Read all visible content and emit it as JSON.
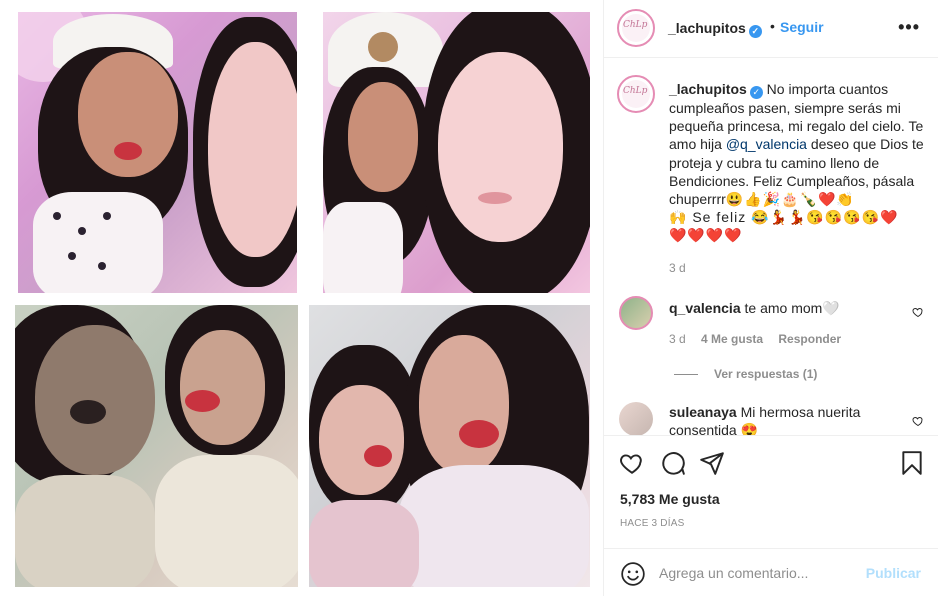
{
  "post": {
    "username": "_lachupitos",
    "verified": "✓",
    "follow_label": "Seguir",
    "separator": "•",
    "more_label": "•••",
    "avatar_glyph": "ChLp",
    "caption_text": " No importa cuantos cumpleaños pasen, siempre serás mi pequeña princesa, mi regalo del cielo. Te amo hija ",
    "caption_mention": "@q_valencia",
    "caption_after": " deseo que Dios te proteja y cubra tu camino lleno de Bendiciones. Feliz Cumpleaños, pásala chuperrrr",
    "caption_emojis_1": "😃👍🎉🎂🍾❤️👏",
    "caption_line_b": "🙌 Se feliz 😂💃💃😘😘😘😘❤️",
    "caption_emojis_2": "❤️❤️❤️❤️",
    "time_ago": "3 d"
  },
  "comments": [
    {
      "username": "q_valencia",
      "text": " te amo mom🤍",
      "time": "3 d",
      "likes": "4 Me gusta",
      "reply": "Responder"
    },
    {
      "username": "suleanaya",
      "text": " Mi hermosa nuerita consentida 😍"
    }
  ],
  "view_replies": "Ver respuestas (1)",
  "likes_count": "5,783 Me gusta",
  "posted_ago": "HACE 3 DÍAS",
  "comment_input": {
    "placeholder": "Agrega un comentario...",
    "submit_label": "Publicar"
  },
  "icons": {
    "like": "heart-icon",
    "comment": "comment-icon",
    "share": "share-icon",
    "save": "bookmark-icon",
    "emoji": "smiley-icon"
  },
  "colors": {
    "link": "#3897f0",
    "mention": "#00376b",
    "muted": "#8e8e8e",
    "publish_disabled": "#b2dffc"
  }
}
